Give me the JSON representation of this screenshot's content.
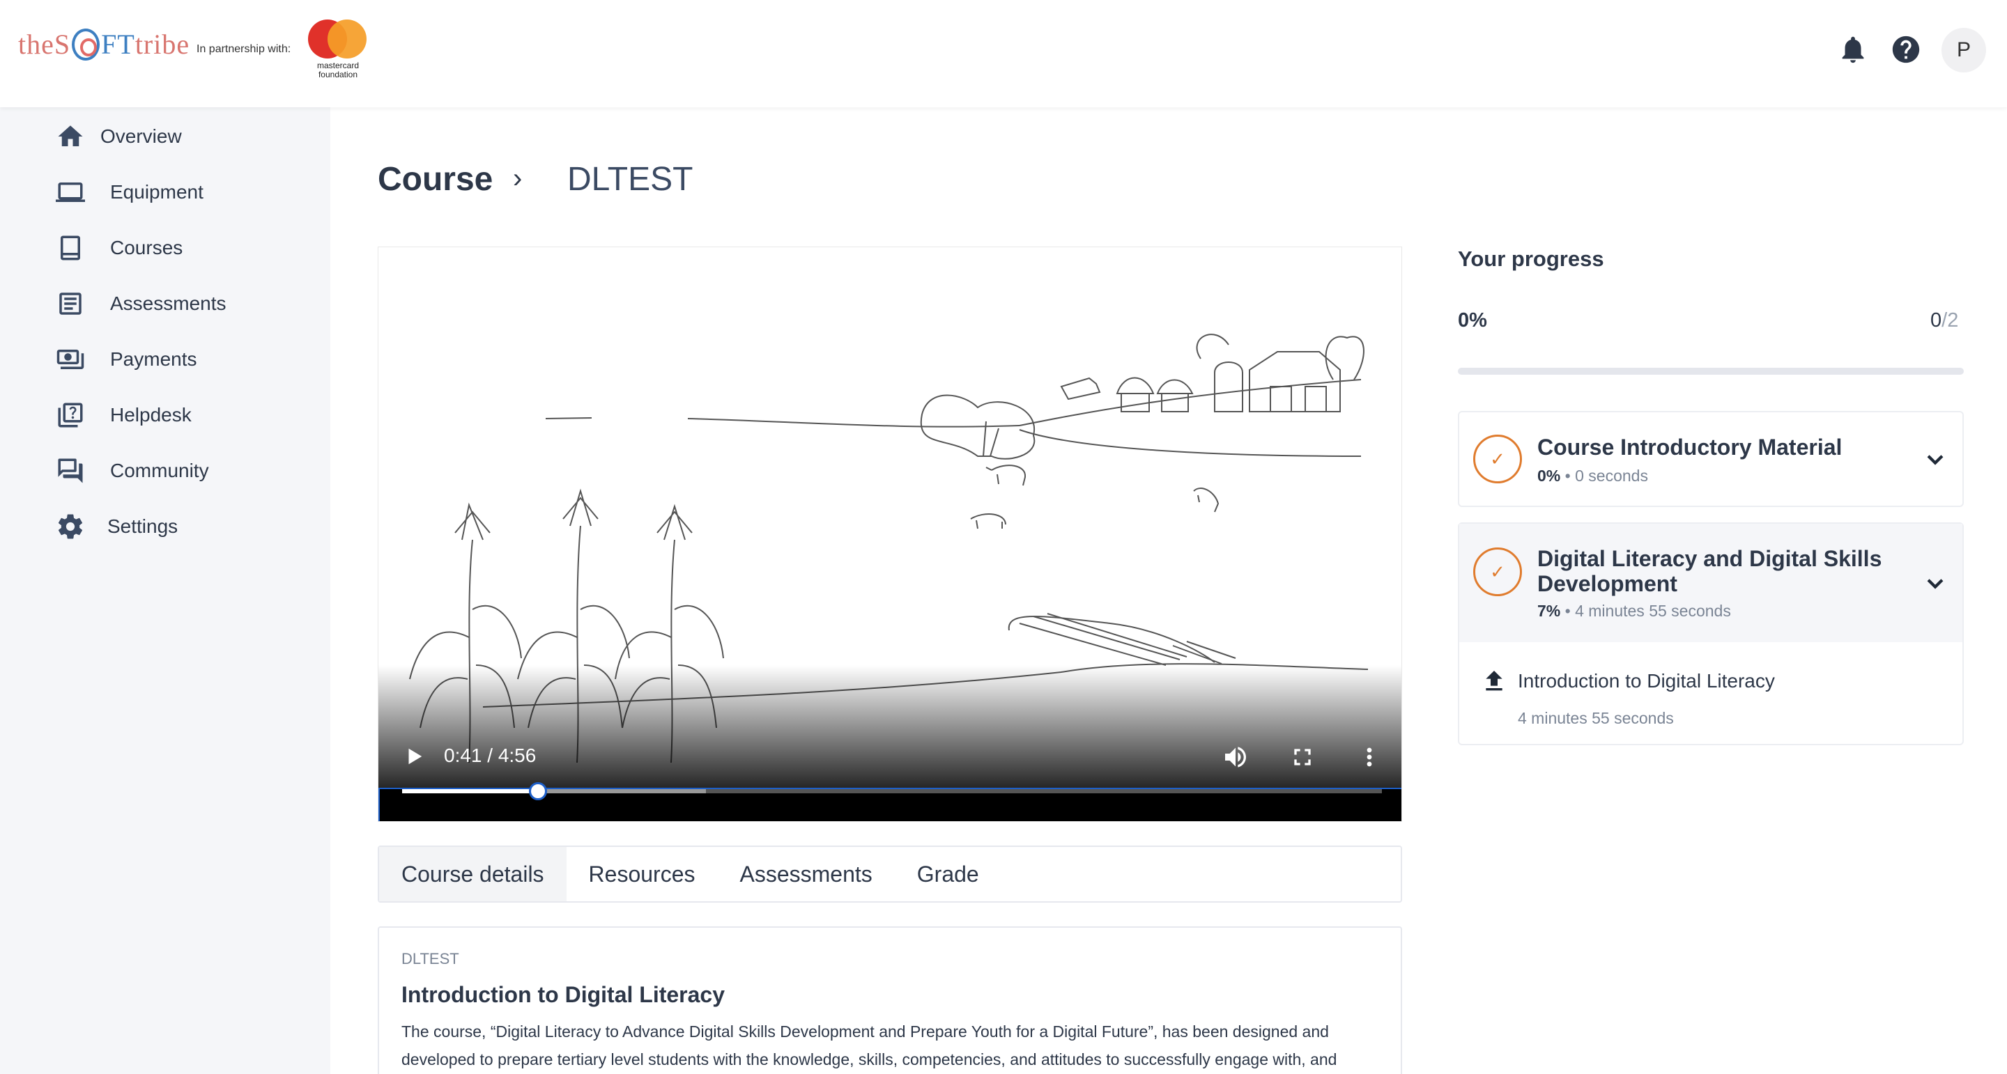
{
  "header": {
    "logo": {
      "part1": "theS",
      "part2": "FT",
      "part3": "tribe"
    },
    "partner_text": "In partnership with:",
    "partner_logo_text": "mastercard foundation",
    "avatar_initial": "P"
  },
  "sidebar": {
    "items": [
      {
        "label": "Overview",
        "icon": "home-icon"
      },
      {
        "label": "Equipment",
        "icon": "laptop-icon"
      },
      {
        "label": "Courses",
        "icon": "book-icon"
      },
      {
        "label": "Assessments",
        "icon": "document-icon"
      },
      {
        "label": "Payments",
        "icon": "payments-icon"
      },
      {
        "label": "Helpdesk",
        "icon": "helpdesk-icon"
      },
      {
        "label": "Community",
        "icon": "forum-icon"
      },
      {
        "label": "Settings",
        "icon": "gear-icon"
      }
    ]
  },
  "breadcrumb": {
    "root": "Course",
    "separator": "›",
    "current": "DLTEST"
  },
  "video": {
    "time": "0:41 / 4:56",
    "played_fraction": 0.139,
    "buffered_fraction": 0.31
  },
  "tabs": [
    {
      "label": "Course details",
      "active": true
    },
    {
      "label": "Resources",
      "active": false
    },
    {
      "label": "Assessments",
      "active": false
    },
    {
      "label": "Grade",
      "active": false
    }
  ],
  "details": {
    "code": "DLTEST",
    "title": "Introduction to Digital Literacy",
    "description": "The course, “Digital Literacy to Advance Digital Skills Development and Prepare Youth for a Digital Future”, has been designed and developed to prepare tertiary level students with the knowledge, skills, competencies, and attitudes to successfully engage with, and"
  },
  "progress": {
    "title": "Your progress",
    "percent": "0%",
    "completed": "0",
    "total": "/2",
    "fill_fraction": 0,
    "modules": [
      {
        "name": "Course Introductory Material",
        "percent": "0%",
        "duration": "0 seconds"
      },
      {
        "name": "Digital Literacy and Digital Skills Development",
        "percent": "7%",
        "duration": "4 minutes 55 seconds",
        "lessons": [
          {
            "name": "Introduction to Digital Literacy",
            "duration": "4 minutes 55 seconds"
          }
        ]
      }
    ]
  },
  "colors": {
    "accent": "#e07c2e",
    "sidebar_bg": "#f5f6f9",
    "text": "#2d3748",
    "focus": "#1d5fc9"
  }
}
